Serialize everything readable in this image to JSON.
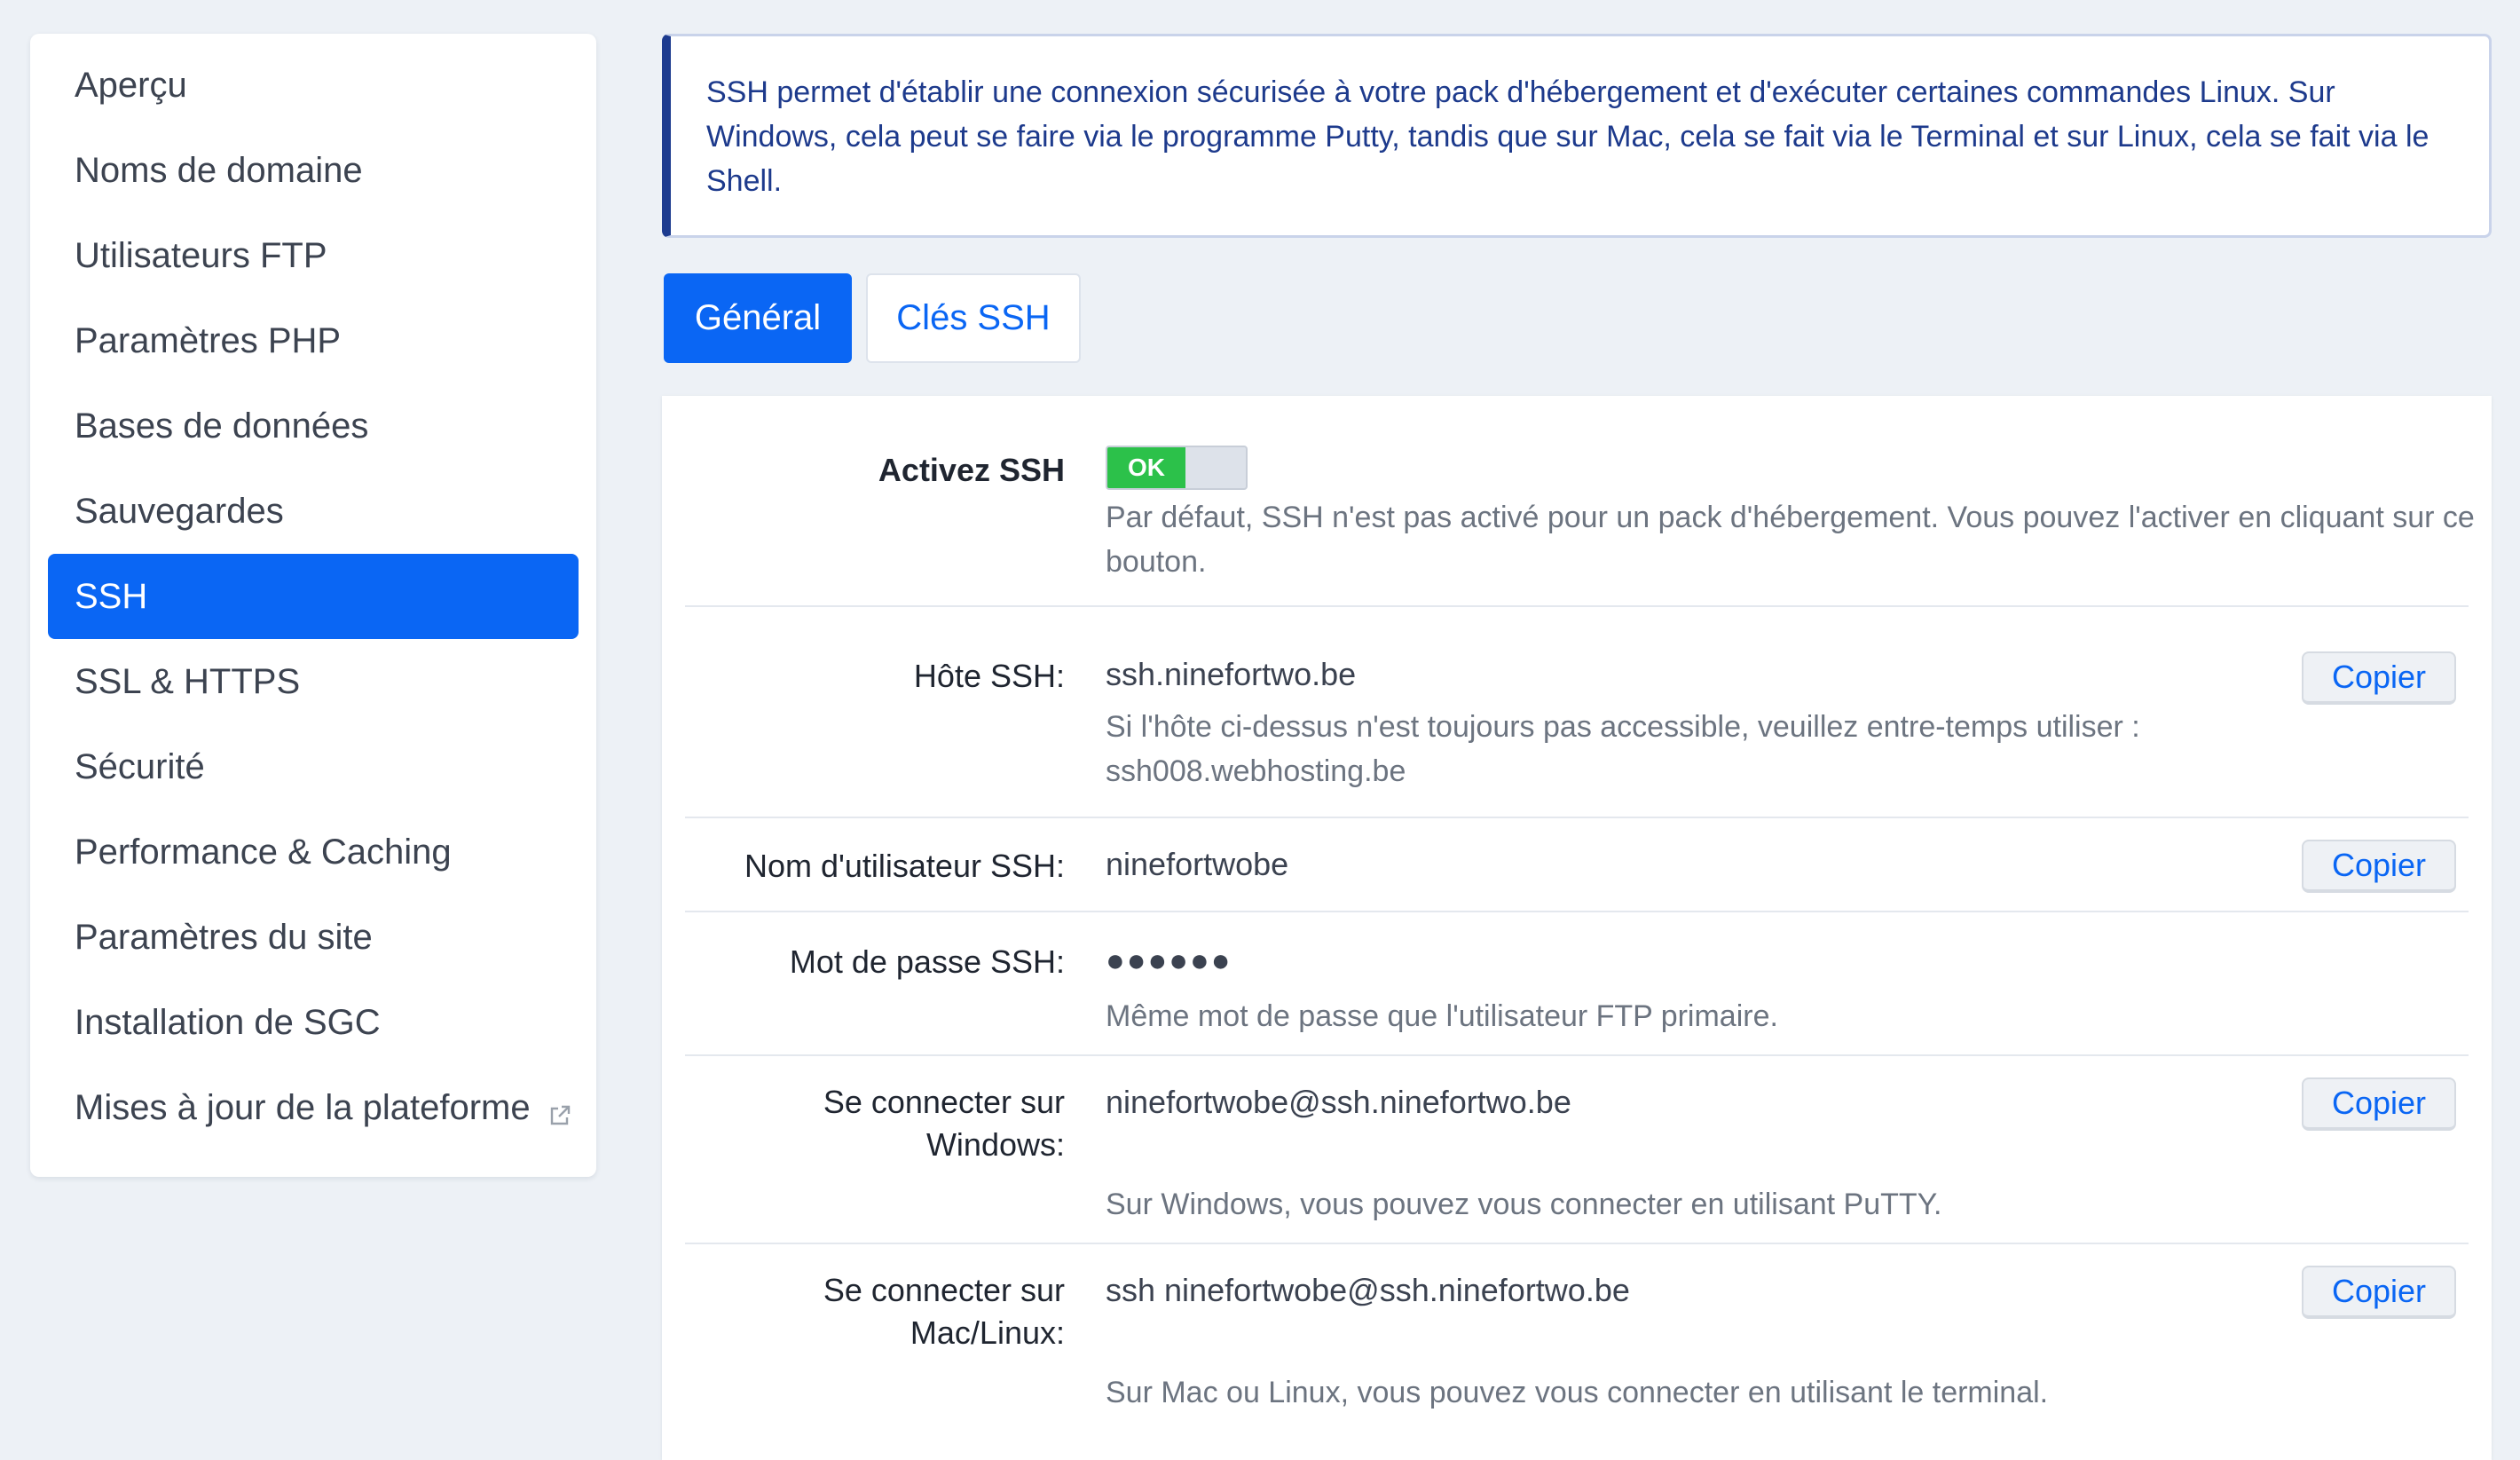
{
  "sidebar": {
    "items": [
      {
        "label": "Aperçu"
      },
      {
        "label": "Noms de domaine"
      },
      {
        "label": "Utilisateurs FTP"
      },
      {
        "label": "Paramètres PHP"
      },
      {
        "label": "Bases de données"
      },
      {
        "label": "Sauvegardes"
      },
      {
        "label": "SSH",
        "active": true
      },
      {
        "label": "SSL & HTTPS"
      },
      {
        "label": "Sécurité"
      },
      {
        "label": "Performance & Caching"
      },
      {
        "label": "Paramètres du site"
      },
      {
        "label": "Installation de SGC"
      },
      {
        "label": "Mises à jour de la plateforme",
        "icon": "external-link-icon"
      }
    ]
  },
  "info": {
    "text": "SSH permet d'établir une connexion sécurisée à votre pack d'hébergement et d'exécuter certaines commandes Linux. Sur Windows, cela peut se faire via le programme Putty, tandis que sur Mac, cela se fait via le Terminal et sur Linux, cela se fait via le Shell."
  },
  "tabs": {
    "general": "Général",
    "keys": "Clés SSH"
  },
  "copy_label": "Copier",
  "fields": {
    "activate": {
      "label": "Activez SSH",
      "toggle_text": "OK",
      "help": "Par défaut, SSH n'est pas activé pour un pack d'hébergement. Vous pouvez l'activer en cliquant sur ce bouton."
    },
    "host": {
      "label": "Hôte SSH:",
      "value": "ssh.ninefortwo.be",
      "help": "Si l'hôte ci-dessus n'est toujours pas accessible, veuillez entre-temps utiliser : ssh008.webhosting.be"
    },
    "username": {
      "label": "Nom d'utilisateur SSH:",
      "value": "ninefortwobe"
    },
    "password": {
      "label": "Mot de passe SSH:",
      "value": "●●●●●●",
      "help": "Même mot de passe que l'utilisateur FTP primaire."
    },
    "windows": {
      "label_line1": "Se connecter sur",
      "label_line2": "Windows:",
      "value": "ninefortwobe@ssh.ninefortwo.be",
      "help": "Sur Windows, vous pouvez vous connecter en utilisant PuTTY."
    },
    "mac": {
      "label_line1": "Se connecter sur",
      "label_line2": "Mac/Linux:",
      "value": "ssh ninefortwobe@ssh.ninefortwo.be",
      "help": "Sur Mac ou Linux, vous pouvez vous connecter en utilisant le terminal."
    }
  },
  "colors": {
    "accent": "#0a66f4",
    "toggle_on": "#2cc14a",
    "banner_border": "#1d3b8f"
  }
}
